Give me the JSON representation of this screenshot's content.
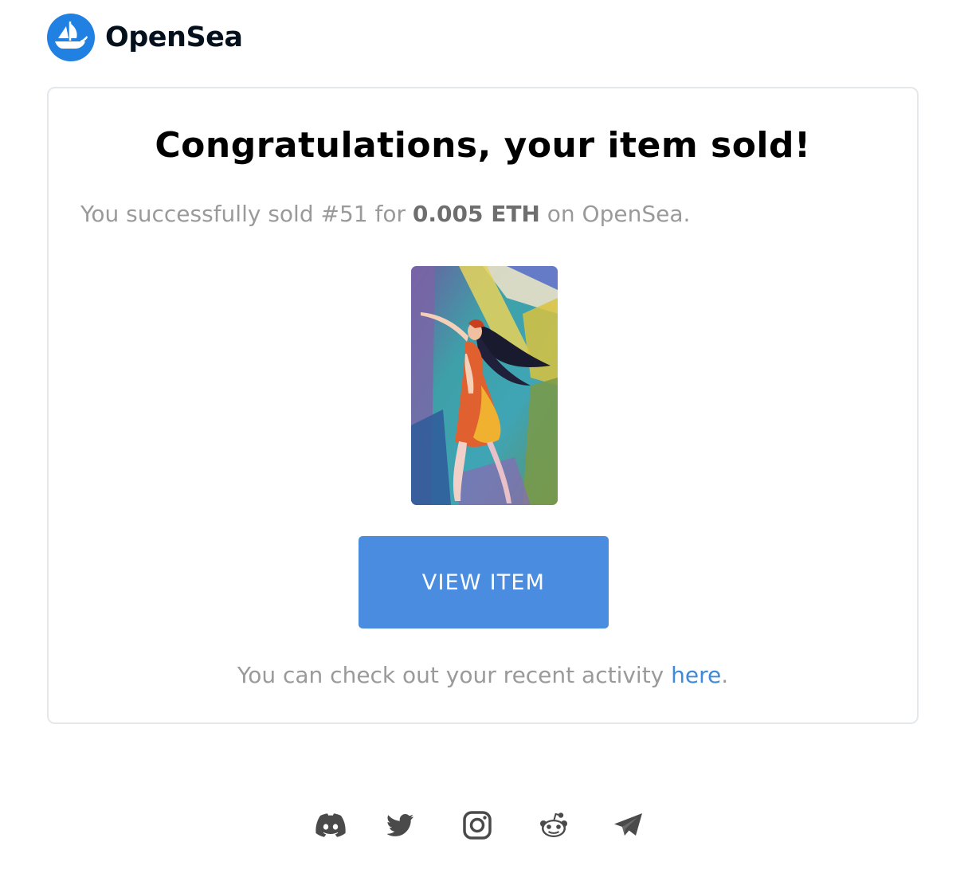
{
  "brand": {
    "name": "OpenSea",
    "accent_color": "#2081e2",
    "logo_icon": "sailboat-icon"
  },
  "card": {
    "headline": "Congratulations, your item sold!",
    "sold_prefix": "You successfully sold #51 for ",
    "sold_price": "0.005 ETH",
    "sold_suffix": " on OpenSea.",
    "artwork_icon": "nft-artwork-dancing-woman",
    "button_label": "VIEW ITEM",
    "button_color": "#4a8de0",
    "activity_prefix": "You can check out your recent activity ",
    "activity_link": "here",
    "activity_suffix": "."
  },
  "footer": {
    "social_icons": [
      "discord-icon",
      "twitter-icon",
      "instagram-icon",
      "reddit-icon",
      "telegram-icon"
    ]
  }
}
